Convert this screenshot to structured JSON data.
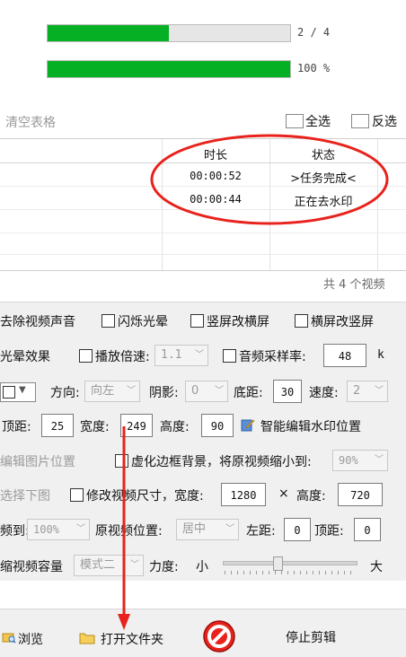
{
  "progress": {
    "bar1": {
      "label": "2 / 4",
      "fraction": 0.5
    },
    "bar2": {
      "label": "100 %",
      "fraction": 1.0
    }
  },
  "toolbar": {
    "clear_table": "清空表格",
    "select_all": "全选",
    "invert": "反选"
  },
  "table": {
    "columns": [
      "时长",
      "状态"
    ],
    "rows": [
      {
        "duration": "00:00:52",
        "status": ">任务完成<"
      },
      {
        "duration": "00:00:44",
        "status": "正在去水印"
      }
    ],
    "footer": "共 4 个视频"
  },
  "settings": {
    "row1": {
      "mute": "去除视频声音",
      "flash": "闪烁光晕",
      "vertical_to_horizontal": "竖屏改横屏",
      "horizontal_to_vertical": "横屏改竖屏"
    },
    "row2": {
      "glow_effect": "光晕效果",
      "speed_label": "播放倍速:",
      "speed_value": "1.1",
      "sample_label": "音频采样率:",
      "sample_value": "48",
      "sample_unit": "k"
    },
    "row3": {
      "direction_label": "方向:",
      "direction_value": "向左",
      "shadow_label": "阴影:",
      "shadow_value": "0",
      "bottom_label": "底距:",
      "bottom_value": "30",
      "speed2_label": "速度:",
      "speed2_value": "2"
    },
    "row4": {
      "top_label": "顶距:",
      "top_value": "25",
      "width_label": "宽度:",
      "width_value": "249",
      "height_label": "高度:",
      "height_value": "90",
      "smart_edit": "智能编辑水印位置"
    },
    "row5": {
      "edit_image_pos": "编辑图片位置",
      "blur_bg": "虚化边框背景，将原视频缩小到:",
      "blur_value": "90%"
    },
    "row6": {
      "choose_image": "选择下图",
      "resize": "修改视频尺寸，宽度:",
      "resize_width": "1280",
      "times": "×",
      "height_label": "高度:",
      "resize_height": "720"
    },
    "row7": {
      "scale_label": "频到:",
      "scale_value": "100%",
      "orig_pos_label": "原视频位置:",
      "orig_pos_value": "居中",
      "left_label": "左距:",
      "left_value": "0",
      "top_label": "顶距:",
      "top_value": "0"
    },
    "row8": {
      "compress_label": "缩视频容量",
      "mode_value": "模式二",
      "strength_label": "力度:",
      "small": "小",
      "large": "大",
      "strength_fraction": 0.4
    }
  },
  "bottom": {
    "browse": "浏览",
    "open_folder": "打开文件夹",
    "stop": "停止剪辑"
  },
  "colors": {
    "progress": "#06b025",
    "annotation": "#e8221c"
  }
}
